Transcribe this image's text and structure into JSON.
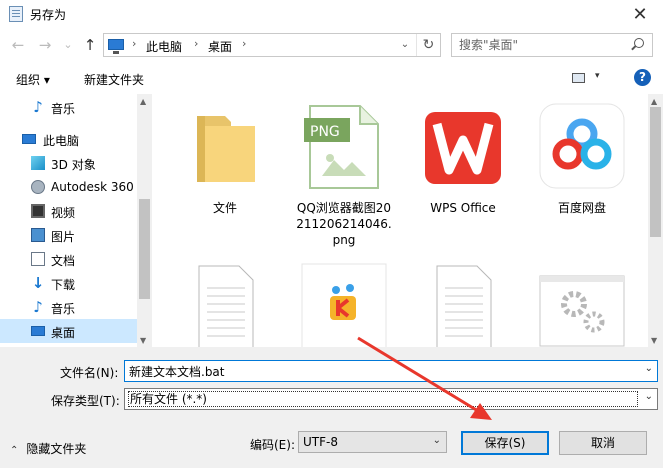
{
  "window": {
    "title": "另存为",
    "close": "✕"
  },
  "nav": {
    "back": "←",
    "forward": "→",
    "recent": "⌄",
    "up": "↑",
    "breadcrumb": [
      "此电脑",
      "桌面"
    ],
    "breadcrumb_sep": "›",
    "dropdown": "⌄",
    "refresh": "↻",
    "search_placeholder": "搜索\"桌面\""
  },
  "toolbar": {
    "organize": "组织 ▾",
    "new_folder": "新建文件夹",
    "view_dd": "▾",
    "help": "?"
  },
  "sidebar": {
    "items": [
      {
        "label": "音乐",
        "icon": "music-icon",
        "glyph": "♪"
      },
      {
        "label": "此电脑",
        "icon": "pc-icon"
      },
      {
        "label": "3D 对象",
        "icon": "cube-icon"
      },
      {
        "label": "Autodesk 360",
        "icon": "disk-icon"
      },
      {
        "label": "视频",
        "icon": "video-icon"
      },
      {
        "label": "图片",
        "icon": "picture-icon"
      },
      {
        "label": "文档",
        "icon": "document-icon"
      },
      {
        "label": "下载",
        "icon": "download-icon",
        "glyph": "↓"
      },
      {
        "label": "音乐",
        "icon": "music-icon",
        "glyph": "♪"
      },
      {
        "label": "桌面",
        "icon": "desktop-icon",
        "selected": true
      }
    ],
    "scroll_up": "▲",
    "scroll_down": "▼"
  },
  "files": [
    {
      "name": "文件",
      "type": "folder"
    },
    {
      "name": "QQ浏览器截图20211206214046.png",
      "type": "png",
      "badge": "PNG"
    },
    {
      "name": "WPS Office",
      "type": "wps"
    },
    {
      "name": "百度网盘",
      "type": "baidu"
    },
    {
      "name": "",
      "type": "text"
    },
    {
      "name": "",
      "type": "kuwo"
    },
    {
      "name": "",
      "type": "text"
    },
    {
      "name": "",
      "type": "config"
    }
  ],
  "form": {
    "filename_label": "文件名(N):",
    "filename_value": "新建文本文档.bat",
    "filetype_label": "保存类型(T):",
    "filetype_value": "所有文件 (*.*)",
    "encoding_label": "编码(E):",
    "encoding_value": "UTF-8",
    "dropdown": "⌄",
    "hide_folders": "隐藏文件夹",
    "hide_chev": "⌃",
    "save": "保存(S)",
    "cancel": "取消"
  },
  "colors": {
    "accent": "#0078d7",
    "selected": "#cce8ff",
    "annotation_arrow": "#e8372c"
  }
}
